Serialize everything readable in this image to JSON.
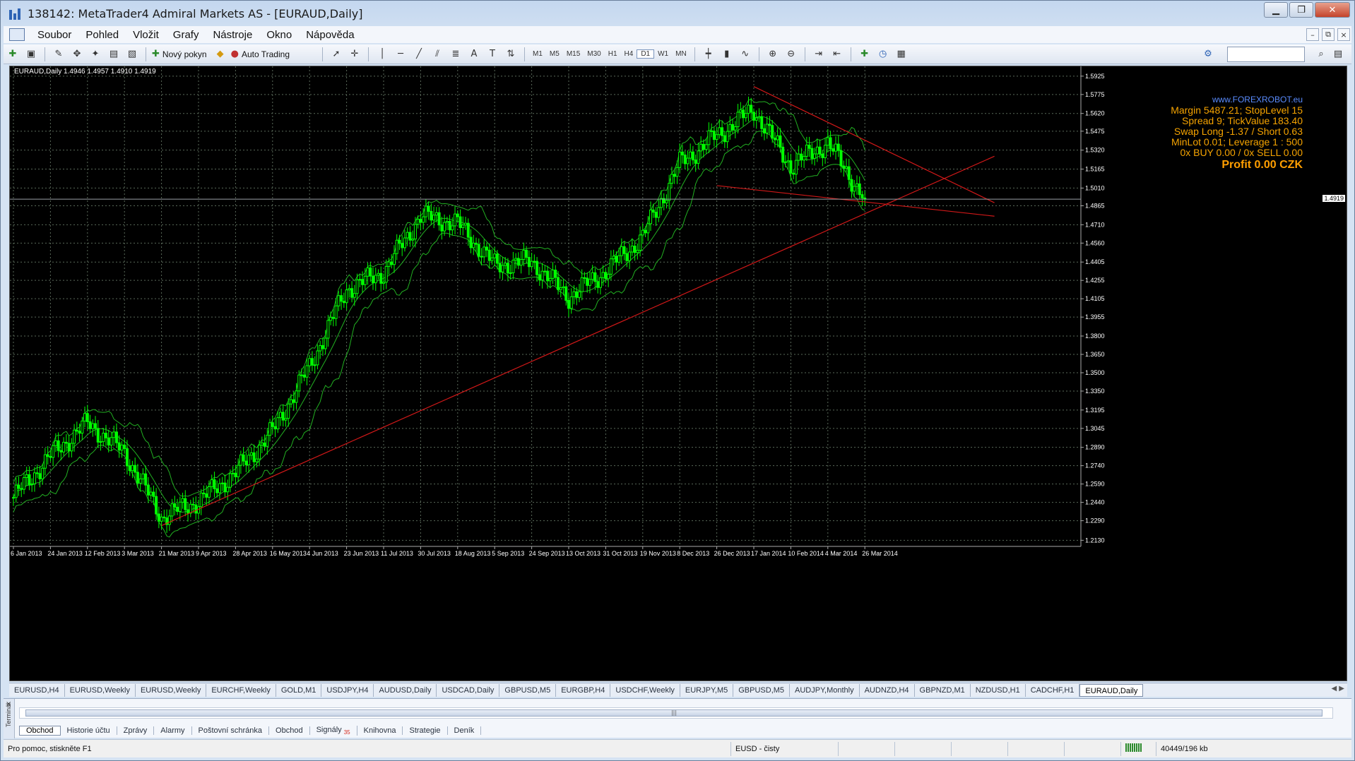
{
  "window": {
    "title": "138142: MetaTrader4 Admiral Markets AS - [EURAUD,Daily]",
    "controls": [
      "▁",
      "❐",
      "✕"
    ]
  },
  "menu": {
    "items": [
      "Soubor",
      "Pohled",
      "Vložit",
      "Grafy",
      "Nástroje",
      "Okno",
      "Nápověda"
    ],
    "mdi_controls": [
      "–",
      "⧉",
      "×"
    ]
  },
  "toolbar": {
    "new_order_label": "Nový pokyn",
    "auto_trading_label": "Auto Trading",
    "timeframes": [
      "M1",
      "M5",
      "M15",
      "M30",
      "H1",
      "H4",
      "D1",
      "W1",
      "MN"
    ],
    "active_timeframe": "D1",
    "draw_tool_text_label": "A",
    "draw_tool_label_label": "T"
  },
  "chart": {
    "caption": "EURAUD,Daily  1.4946 1.4957 1.4910 1.4919",
    "current_price": "1.4919",
    "info": {
      "url": "www.FOREXROBOT.eu",
      "line1": "Margin 5487.21; StopLevel 15",
      "line2": "Spread 9; TickValue 183.40",
      "line3": "Swap Long -1.37 / Short 0.63",
      "line4": "MinLot 0.01; Leverage 1 : 500",
      "line5": "0x BUY 0.00 / 0x SELL 0.00",
      "profit": "Profit 0.00 CZK"
    },
    "colors": {
      "candle": "#00ff00",
      "bands": "#22b022",
      "trendline": "#d01818",
      "grid": "#5a6a5a",
      "background": "#000000"
    }
  },
  "chart_data": {
    "type": "candlestick",
    "symbol": "EURAUD",
    "timeframe": "Daily",
    "y_ticks": [
      1.5925,
      1.5775,
      1.562,
      1.5475,
      1.532,
      1.5165,
      1.501,
      1.4865,
      1.471,
      1.456,
      1.4405,
      1.4255,
      1.4105,
      1.3955,
      1.38,
      1.365,
      1.35,
      1.335,
      1.3195,
      1.3045,
      1.289,
      1.274,
      1.259,
      1.244,
      1.229,
      1.213
    ],
    "y_tick_labels": [
      "1.5925",
      "1.5775",
      "1.5620",
      "1.5475",
      "1.5320",
      "1.5165",
      "1.5010",
      "1.4865",
      "1.4710",
      "1.4560",
      "1.4405",
      "1.4255",
      "1.4105",
      "1.3955",
      "1.3800",
      "1.3650",
      "1.3500",
      "1.3350",
      "1.3195",
      "1.3045",
      "1.2890",
      "1.2740",
      "1.2590",
      "1.2440",
      "1.2290",
      "1.2130"
    ],
    "ylim": [
      1.208,
      1.6005
    ],
    "x_tick_labels": [
      "6 Jan 2013",
      "24 Jan 2013",
      "12 Feb 2013",
      "3 Mar 2013",
      "21 Mar 2013",
      "9 Apr 2013",
      "28 Apr 2013",
      "16 May 2013",
      "4 Jun 2013",
      "23 Jun 2013",
      "11 Jul 2013",
      "30 Jul 2013",
      "18 Aug 2013",
      "5 Sep 2013",
      "24 Sep 2013",
      "13 Oct 2013",
      "31 Oct 2013",
      "19 Nov 2013",
      "8 Dec 2013",
      "26 Dec 2013",
      "17 Jan 2014",
      "10 Feb 2014",
      "4 Mar 2014",
      "26 Mar 2014"
    ],
    "close_path": [
      [
        "6 Jan 2013",
        1.248
      ],
      [
        "24 Jan 2013",
        1.282
      ],
      [
        "12 Feb 2013",
        1.309
      ],
      [
        "3 Mar 2013",
        1.285
      ],
      [
        "21 Mar 2013",
        1.232
      ],
      [
        "9 Apr 2013",
        1.245
      ],
      [
        "28 Apr 2013",
        1.268
      ],
      [
        "16 May 2013",
        1.302
      ],
      [
        "4 Jun 2013",
        1.355
      ],
      [
        "23 Jun 2013",
        1.418
      ],
      [
        "11 Jul 2013",
        1.432
      ],
      [
        "30 Jul 2013",
        1.478
      ],
      [
        "18 Aug 2013",
        1.472
      ],
      [
        "5 Sep 2013",
        1.438
      ],
      [
        "24 Sep 2013",
        1.441
      ],
      [
        "13 Oct 2013",
        1.412
      ],
      [
        "31 Oct 2013",
        1.433
      ],
      [
        "19 Nov 2013",
        1.461
      ],
      [
        "8 Dec 2013",
        1.521
      ],
      [
        "26 Dec 2013",
        1.544
      ],
      [
        "17 Jan 2014",
        1.565
      ],
      [
        "10 Feb 2014",
        1.519
      ],
      [
        "4 Mar 2014",
        1.538
      ],
      [
        "26 Mar 2014",
        1.4919
      ]
    ],
    "trendlines": [
      {
        "from": [
          "21 Mar 2013",
          1.225
        ],
        "to": [
          "26 Mar 2014+",
          1.527
        ]
      },
      {
        "from": [
          "17 Jan 2014",
          1.584
        ],
        "to": [
          "26 Mar 2014+",
          1.489
        ]
      },
      {
        "from": [
          "26 Dec 2013",
          1.503
        ],
        "to": [
          "26 Mar 2014+",
          1.478
        ]
      }
    ],
    "grid": true
  },
  "chart_tabs": {
    "items": [
      "EURUSD,H4",
      "EURUSD,Weekly",
      "EURUSD,Weekly",
      "EURCHF,Weekly",
      "GOLD,M1",
      "USDJPY,H4",
      "AUDUSD,Daily",
      "USDCAD,Daily",
      "GBPUSD,M5",
      "EURGBP,H4",
      "USDCHF,Weekly",
      "EURJPY,M5",
      "GBPUSD,M5",
      "AUDJPY,Monthly",
      "AUDNZD,H4",
      "GBPNZD,M1",
      "NZDUSD,H1",
      "CADCHF,H1",
      "EURAUD,Daily"
    ],
    "active": "EURAUD,Daily"
  },
  "terminal": {
    "side_label": "Terminál",
    "tabs": [
      "Obchod",
      "Historie účtu",
      "Zprávy",
      "Alarmy",
      "Poštovní schránka",
      "Obchod",
      "Signály",
      "Knihovna",
      "Strategie",
      "Deník"
    ],
    "signals_badge": "35",
    "active_tab": "Obchod"
  },
  "status": {
    "help": "Pro pomoc, stiskněte F1",
    "profile": "EUSD - čisty",
    "traffic": "40449/196 kb"
  }
}
